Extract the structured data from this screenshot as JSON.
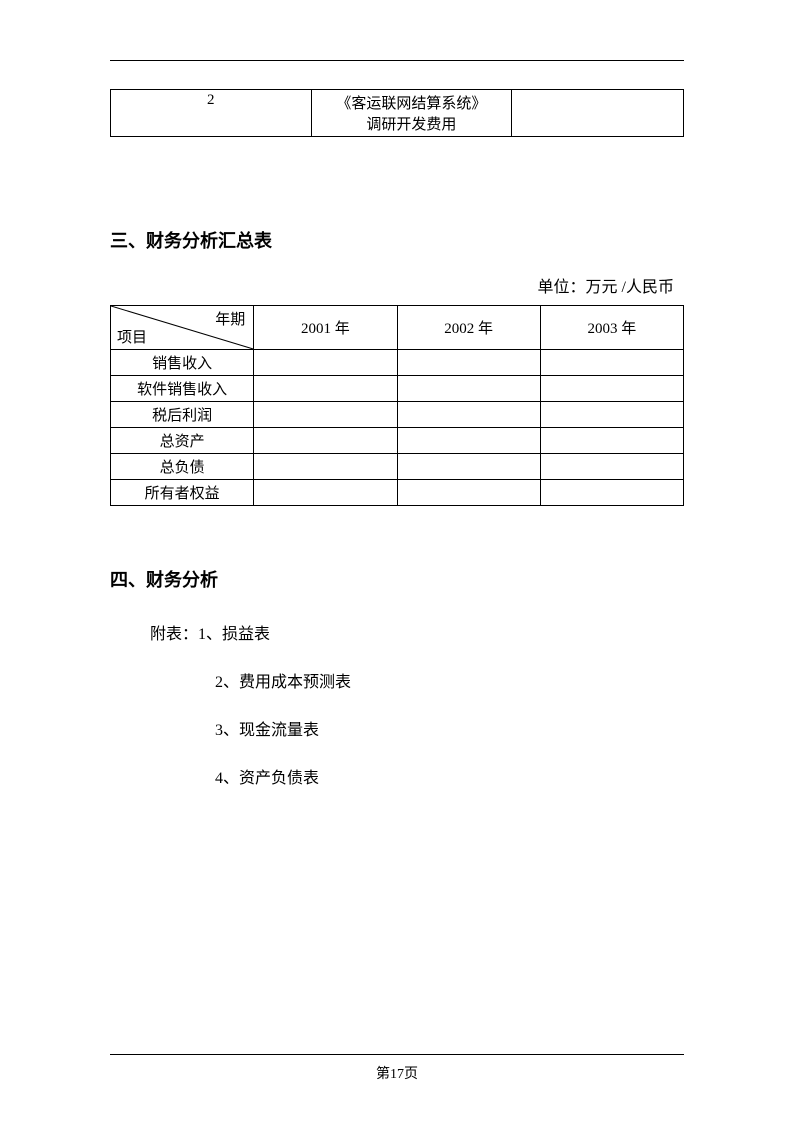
{
  "table1": {
    "col1": "2",
    "col2_line1": "《客运联网结算系统》",
    "col2_line2": "调研开发费用",
    "col3": ""
  },
  "section3": {
    "title": "三、财务分析汇总表",
    "unit": "单位：万元 /人民币",
    "diag_top": "年期",
    "diag_bottom": "项目",
    "headers": [
      "2001 年",
      "2002 年",
      "2003 年"
    ],
    "rows": [
      "销售收入",
      "软件销售收入",
      "税后利润",
      "总资产",
      "总负债",
      "所有者权益"
    ]
  },
  "section4": {
    "title": "四、财务分析",
    "attach_label": "附表：1、损益表",
    "items": [
      "2、费用成本预测表",
      "3、现金流量表",
      "4、资产负债表"
    ]
  },
  "footer": {
    "page": "第17页"
  }
}
